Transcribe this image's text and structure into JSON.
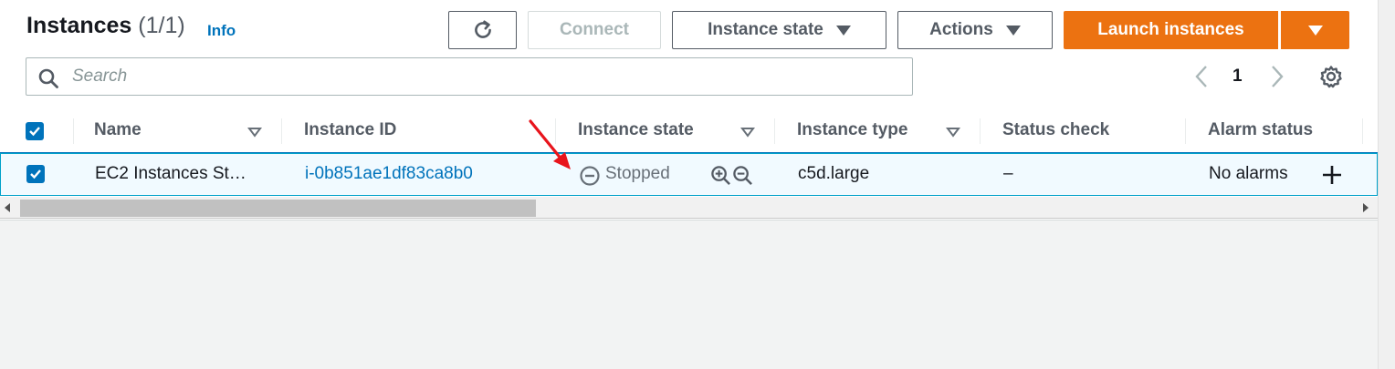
{
  "header": {
    "title": "Instances",
    "count": "(1/1)",
    "info_label": "Info"
  },
  "toolbar": {
    "refresh_icon": "refresh-icon",
    "connect_label": "Connect",
    "instance_state_label": "Instance state",
    "actions_label": "Actions",
    "launch_label": "Launch instances"
  },
  "search": {
    "placeholder": "Search",
    "value": ""
  },
  "pagination": {
    "current_page": "1"
  },
  "table": {
    "columns": [
      "Name",
      "Instance ID",
      "Instance state",
      "Instance type",
      "Status check",
      "Alarm status"
    ],
    "rows": [
      {
        "selected": true,
        "name": "EC2 Instances St…",
        "instance_id": "i-0b851ae1df83ca8b0",
        "instance_state": "Stopped",
        "instance_type": "c5d.large",
        "status_check": "–",
        "alarm_status": "No alarms"
      }
    ]
  },
  "colors": {
    "primary": "#ec7211",
    "link": "#0073bb",
    "selection_bg": "#f1faff",
    "annotation_arrow": "#e8141c"
  }
}
